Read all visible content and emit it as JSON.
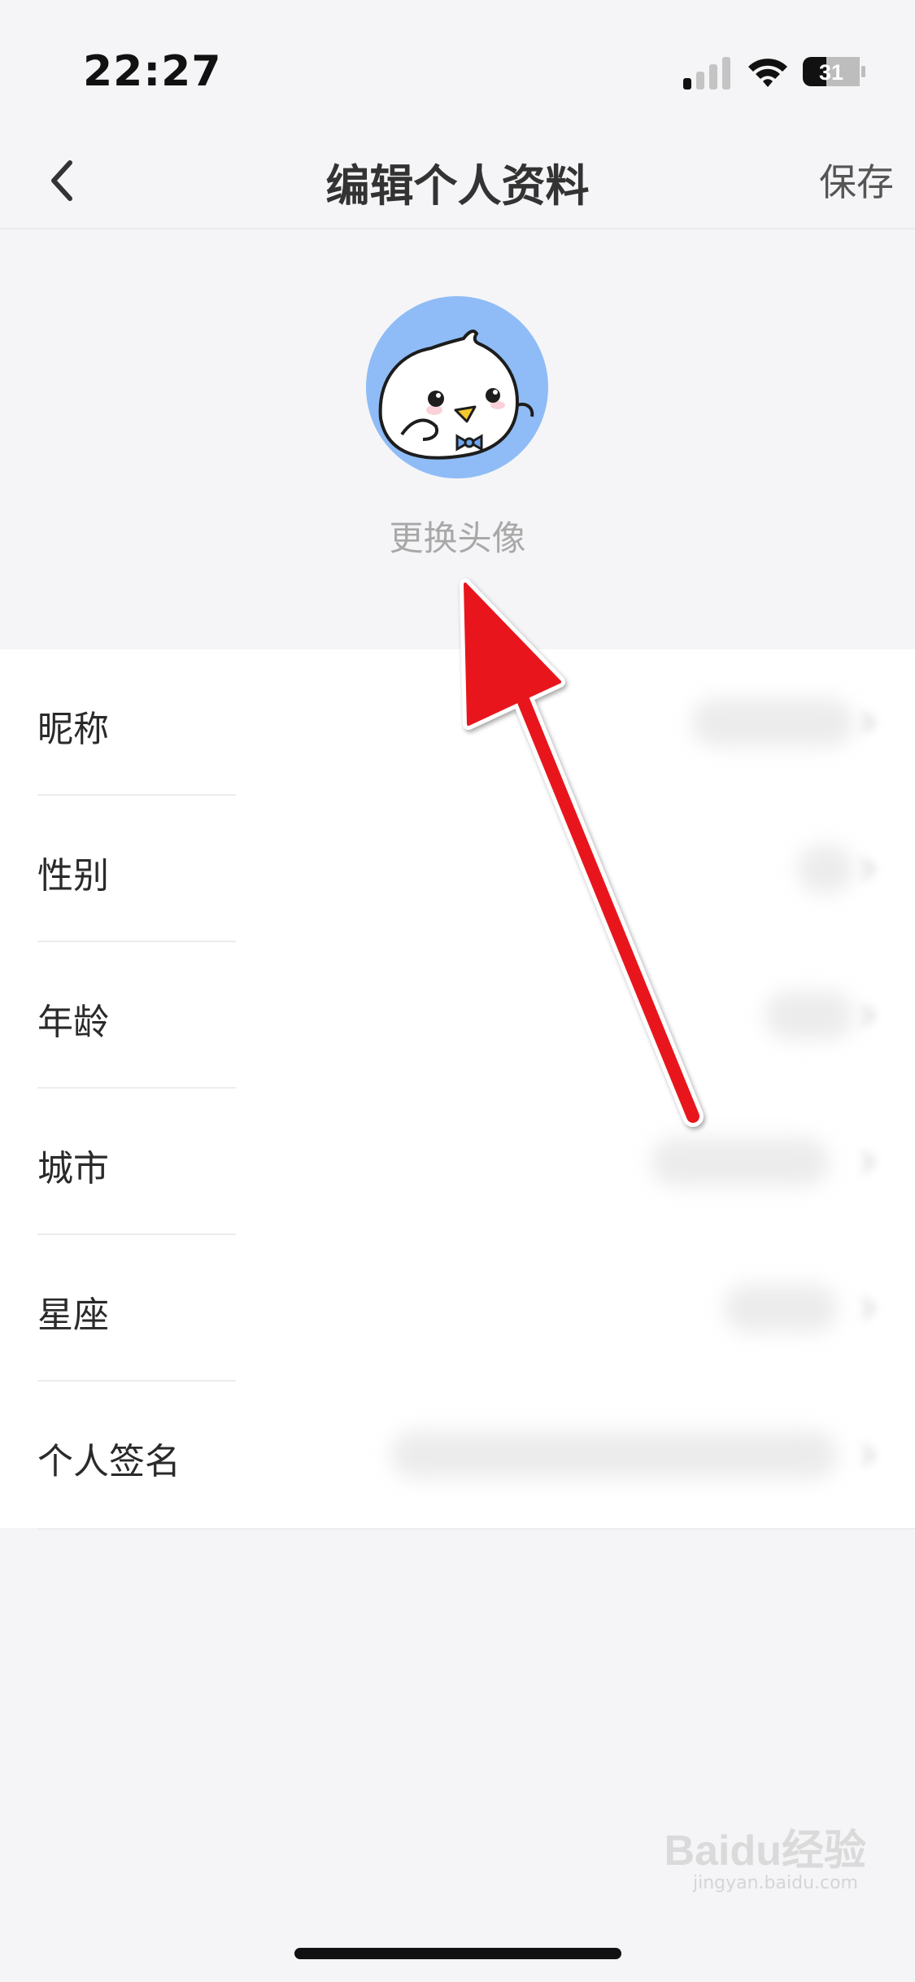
{
  "status_bar": {
    "time": "22:27",
    "battery_level": "31",
    "icons": [
      "signal-icon",
      "wifi-icon",
      "battery-icon"
    ]
  },
  "nav": {
    "title": "编辑个人资料",
    "save_label": "保存",
    "back_icon": "chevron-left-icon"
  },
  "avatar": {
    "change_label": "更换头像",
    "bg_color": "#8fbcf6"
  },
  "form": {
    "rows": [
      {
        "label": "昵称"
      },
      {
        "label": "性别"
      },
      {
        "label": "年龄"
      },
      {
        "label": "城市"
      },
      {
        "label": "星座"
      },
      {
        "label": "个人签名"
      }
    ]
  },
  "annotation": {
    "arrow_color": "#e8131b",
    "arrow_icon": "red-arrow-annotation"
  },
  "watermark": {
    "text": "Baidu经验",
    "sub": "jingyan.baidu.com"
  }
}
